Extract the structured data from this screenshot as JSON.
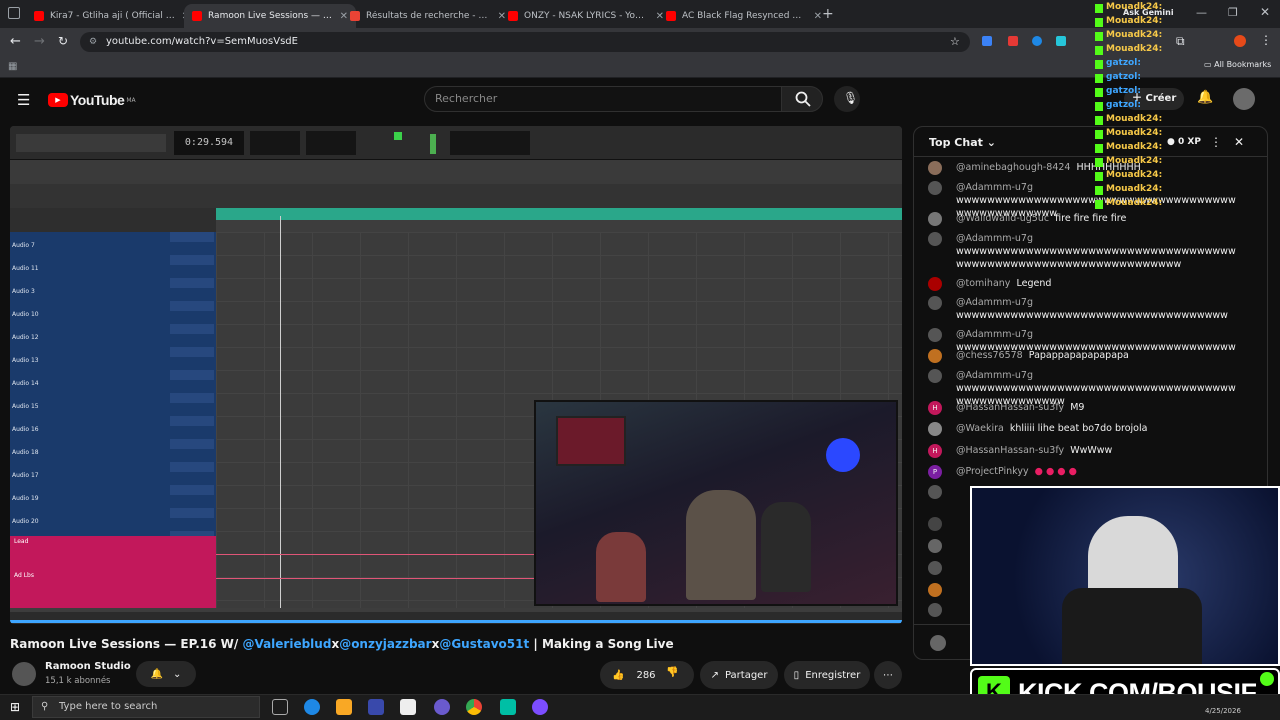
{
  "browser": {
    "tabs": [
      {
        "title": "Kira7 - Gtliha aji ( Official Visual",
        "color": "#ff0000",
        "active": false
      },
      {
        "title": "Ramoon Live Sessions — EP.16 W/",
        "color": "#ff0000",
        "active": true
      },
      {
        "title": "Résultats de recherche - noem",
        "color": "#ea4335",
        "active": false
      },
      {
        "title": "ONZY - NSAK LYRICS - YouTube",
        "color": "#ff0000",
        "active": false
      },
      {
        "title": "AC Black Flag Resynced DLSS 5",
        "color": "#ff0000",
        "active": false
      }
    ],
    "url": "youtube.com/watch?v=SemMuosVsdE",
    "all_bookmarks": "All Bookmarks"
  },
  "youtube": {
    "logo_text": "YouTube",
    "logo_region": "MA",
    "search_placeholder": "Rechercher",
    "create_label": "Créer",
    "video_title_prefix": "Ramoon Live Sessions — EP.16 W/ ",
    "mention_1": "@Valerieblud",
    "x1": "x",
    "mention_2": "@onzyjazzbar",
    "x2": "x",
    "mention_3": "@Gustavo51t",
    "video_title_suffix": " | Making a Song Live",
    "channel_name": "Ramoon Studio",
    "subscribers": "15,1 k abonnés",
    "likes": "286",
    "share_label": "Partager",
    "save_label": "Enregistrer"
  },
  "daw": {
    "time": "0:29.594",
    "tracks": [
      "Audio 7",
      "Audio 11",
      "Audio 3",
      "Audio 10",
      "Audio 12",
      "Audio 13",
      "Audio 14",
      "Audio 15",
      "Audio 16",
      "Audio 18",
      "Audio 17",
      "Audio 19",
      "Audio 20",
      "Audio 21"
    ],
    "bottom_tracks": [
      "Lead",
      "Ad Lbs"
    ]
  },
  "chat": {
    "header": "Top Chat",
    "messages": [
      {
        "author": "@aminebaghough-8424",
        "text": "HHHHHHHHH",
        "color": "#8a6d5a"
      },
      {
        "author": "@Adammm-u7g",
        "text": "wwwwwwwwwwwwwwwwwwwwwwwwwwwwwwwwwwwwwwwwwwwwwwwww",
        "color": "#555"
      },
      {
        "author": "@Walidwalid-ug5uc",
        "text": "fire fire fire fire",
        "color": "#777"
      },
      {
        "author": "@Adammm-u7g",
        "text": "wwwwwwwwwwwwwwwwwwwwwwwwwwwwwwwwwwwwwwwwwwwwwwwwwwwwwwwwwwwwwwwww",
        "color": "#555"
      },
      {
        "author": "@tomihany",
        "text": "Legend",
        "color": "#a00"
      },
      {
        "author": "@Adammm-u7g",
        "text": "wwwwwwwwwwwwwwwwwwwwwwwwwwwwwwwwwww",
        "color": "#555"
      },
      {
        "author": "@Adammm-u7g",
        "text": "wwwwwwwwwwwwwwwwwwwwwwwwwwwwwwwwwwww",
        "color": "#555"
      },
      {
        "author": "@chess76578",
        "text": "Papappapapapapapa",
        "color": "#c07020"
      },
      {
        "author": "@Adammm-u7g",
        "text": "wwwwwwwwwwwwwwwwwwwwwwwwwwwwwwwwwwwwwwwwwwwwwwwwww",
        "color": "#555"
      },
      {
        "author": "@HassanHassan-su3fy",
        "text": "M9",
        "color": "#c2185b"
      },
      {
        "author": "@Waekira",
        "text": "khliiii lihe beat bo7do brojola",
        "color": "#888"
      },
      {
        "author": "@HassanHassan-su3fy",
        "text": "WwWww",
        "color": "#c2185b"
      },
      {
        "author": "@ProjectPinkyy",
        "text": "",
        "color": "#7b1fa2"
      }
    ],
    "initials": {
      "h": "H",
      "p": "P"
    }
  },
  "overlay": {
    "kick_text": "KICK.COM/BOUSIF",
    "kick_letter": "K",
    "ask_gemini": "Ask Gemini",
    "xp": "0 XP",
    "side_names": [
      "Mouadk24:",
      "Mouadk24:",
      "Mouadk24:",
      "Mouadk24:",
      "gatzol:",
      "gatzol:",
      "gatzol:",
      "gatzol:",
      "Mouadk24:",
      "Mouadk24:",
      "Mouadk24:",
      "Mouadk24:",
      "Mouadk24:",
      "Mouadk24:",
      "Mouadk24:"
    ]
  },
  "taskbar": {
    "search_placeholder": "Type here to search",
    "date": "4/25/2026"
  },
  "colors": {
    "yt_red": "#ff0000",
    "kick_green": "#53fc18",
    "daw_blue": "#1a3a6b",
    "daw_pink": "#c2185b"
  }
}
